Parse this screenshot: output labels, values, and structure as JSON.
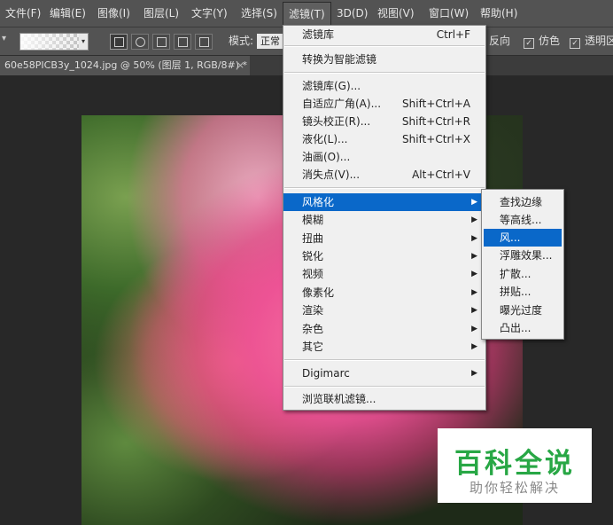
{
  "menubar": {
    "items": [
      "文件(F)",
      "编辑(E)",
      "图像(I)",
      "图层(L)",
      "文字(Y)",
      "选择(S)",
      "滤镜(T)",
      "3D(D)",
      "视图(V)",
      "窗口(W)",
      "帮助(H)"
    ]
  },
  "options": {
    "mode_label": "模式:",
    "mode_value": "正常",
    "reverse_label": "反向",
    "dither_label": "仿色",
    "transparency_label": "透明区"
  },
  "tab": {
    "title": "60e58PICB3y_1024.jpg @ 50% (图层 1, RGB/8#) *",
    "close": "×"
  },
  "filter_menu": {
    "top": [
      {
        "label": "滤镜库",
        "shortcut": "Ctrl+F"
      },
      {
        "label": "转换为智能滤镜",
        "shortcut": ""
      }
    ],
    "mid": [
      {
        "label": "滤镜库(G)...",
        "shortcut": ""
      },
      {
        "label": "自适应广角(A)...",
        "shortcut": "Shift+Ctrl+A"
      },
      {
        "label": "镜头校正(R)...",
        "shortcut": "Shift+Ctrl+R"
      },
      {
        "label": "液化(L)...",
        "shortcut": "Shift+Ctrl+X"
      },
      {
        "label": "油画(O)...",
        "shortcut": ""
      },
      {
        "label": "消失点(V)...",
        "shortcut": "Alt+Ctrl+V"
      }
    ],
    "groups": [
      "风格化",
      "模糊",
      "扭曲",
      "锐化",
      "视频",
      "像素化",
      "渲染",
      "杂色",
      "其它"
    ],
    "digimarc": "Digimarc",
    "browse": "浏览联机滤镜...",
    "arrow": "▶"
  },
  "stylize_submenu": [
    "查找边缘",
    "等高线...",
    "风...",
    "浮雕效果...",
    "扩散...",
    "拼贴...",
    "曝光过度",
    "凸出..."
  ],
  "watermark": {
    "main": "百科全说",
    "sub": "助你轻松解决"
  }
}
